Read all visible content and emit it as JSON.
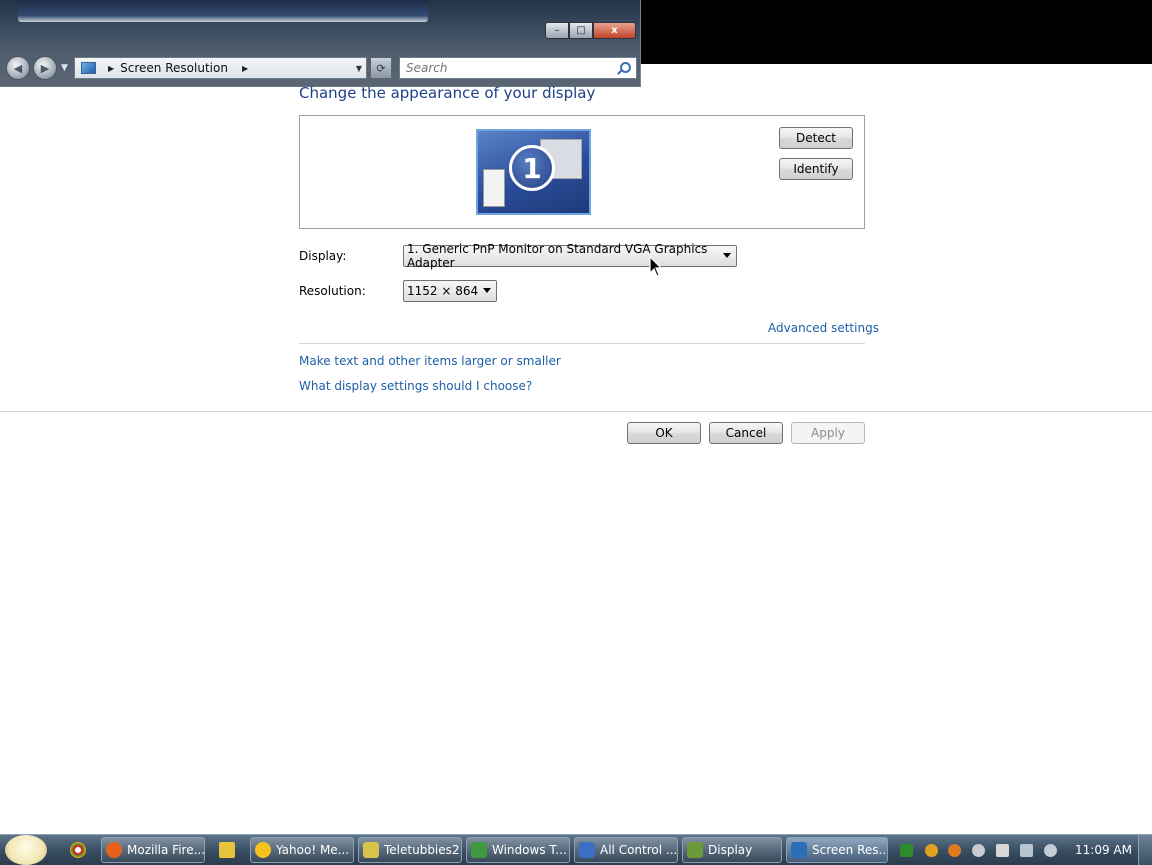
{
  "window": {
    "breadcrumb": "Screen Resolution",
    "search_placeholder": "Search",
    "controls": {
      "minimize": "–",
      "maximize": "□",
      "close": "x"
    }
  },
  "main": {
    "heading": "Change the appearance of your display",
    "monitor_number": "1",
    "detect_label": "Detect",
    "identify_label": "Identify",
    "display_label": "Display:",
    "display_value": "1. Generic PnP Monitor on Standard VGA Graphics Adapter",
    "resolution_label": "Resolution:",
    "resolution_value": "1152 × 864",
    "advanced_link": "Advanced settings",
    "link_text_size": "Make text and other items larger or smaller",
    "link_help": "What display settings should I choose?",
    "ok_label": "OK",
    "cancel_label": "Cancel",
    "apply_label": "Apply"
  },
  "taskbar": {
    "items": [
      {
        "label": "Mozilla Fire...",
        "icon": "firefox-icon",
        "color": "#e8611b"
      },
      {
        "label": "Yahoo! Me...",
        "icon": "yahoo-messenger-icon",
        "color": "#f4c21a"
      },
      {
        "label": "Teletubbies2",
        "icon": "star-icon",
        "color": "#d8c24a"
      },
      {
        "label": "Windows T...",
        "icon": "task-manager-icon",
        "color": "#3f9a3f"
      },
      {
        "label": "All Control ...",
        "icon": "control-panel-icon",
        "color": "#3a6fc4"
      },
      {
        "label": "Display",
        "icon": "display-settings-icon",
        "color": "#6b9a3a"
      },
      {
        "label": "Screen Res...",
        "icon": "screen-resolution-icon",
        "color": "#2a6fb8"
      }
    ],
    "clock": "11:09 AM",
    "colors": {
      "accent": "#1e3f8a",
      "link": "#1e5fa8"
    }
  }
}
